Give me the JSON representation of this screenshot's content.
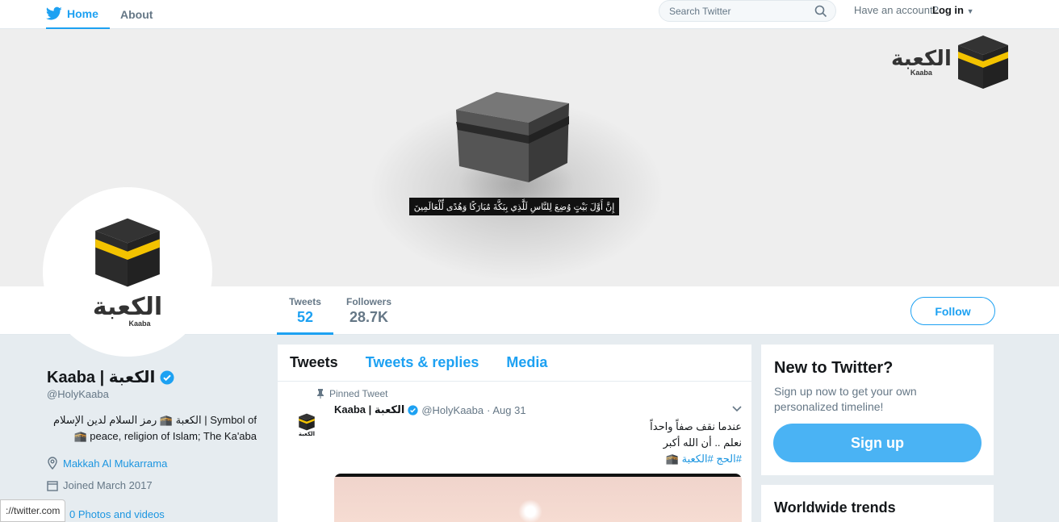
{
  "topnav": {
    "home_label": "Home",
    "about_label": "About",
    "search_placeholder": "Search Twitter",
    "have_account": "Have an account?",
    "login_label": "Log in"
  },
  "banner": {
    "verse": "إِنَّ أَوَّلَ بَيْتٍ وُضِعَ لِلنَّاسِ لَلَّذِي بِبَكَّةَ مُبَارَكًا وَهُدًى لِّلْعَالَمِينَ",
    "logo_ar": "الكعبة",
    "logo_en": "Kaaba"
  },
  "avatar": {
    "logo_ar": "الكعبة",
    "logo_en": "Kaaba"
  },
  "profile_nav": {
    "tweets_label": "Tweets",
    "tweets_count": "52",
    "followers_label": "Followers",
    "followers_count": "28.7K",
    "follow_label": "Follow"
  },
  "profile": {
    "name": "Kaaba | الكعبة",
    "handle": "@HolyKaaba",
    "bio_line1": "الكعبة 🕋 رمز السلام لدين الإسلام | Symbol of",
    "bio_line2": "🕋 peace, religion of Islam; The Ka'aba",
    "location": "Makkah Al Mukarrama",
    "joined": "Joined March 2017",
    "photos_link": "0 Photos and videos"
  },
  "statusbar": "://twitter.com",
  "timeline": {
    "tabs": [
      "Tweets",
      "Tweets & replies",
      "Media"
    ],
    "pinned_label": "Pinned Tweet",
    "tweet": {
      "name": "Kaaba | الكعبة",
      "handle": "@HolyKaaba",
      "date": "· Aug 31",
      "line1": "عندما نقف صفاً واحداً",
      "line2": "نعلم .. أن الله أكبر",
      "tags": "#الحج #الكعبة 🕋"
    }
  },
  "signup": {
    "title": "New to Twitter?",
    "description": "Sign up now to get your own personalized timeline!",
    "button": "Sign up"
  },
  "trends": {
    "title": "Worldwide trends"
  },
  "colors": {
    "accent": "#1da1f2",
    "kaaba_gold": "#f3c300",
    "kaaba_black": "#2b2b2b"
  }
}
